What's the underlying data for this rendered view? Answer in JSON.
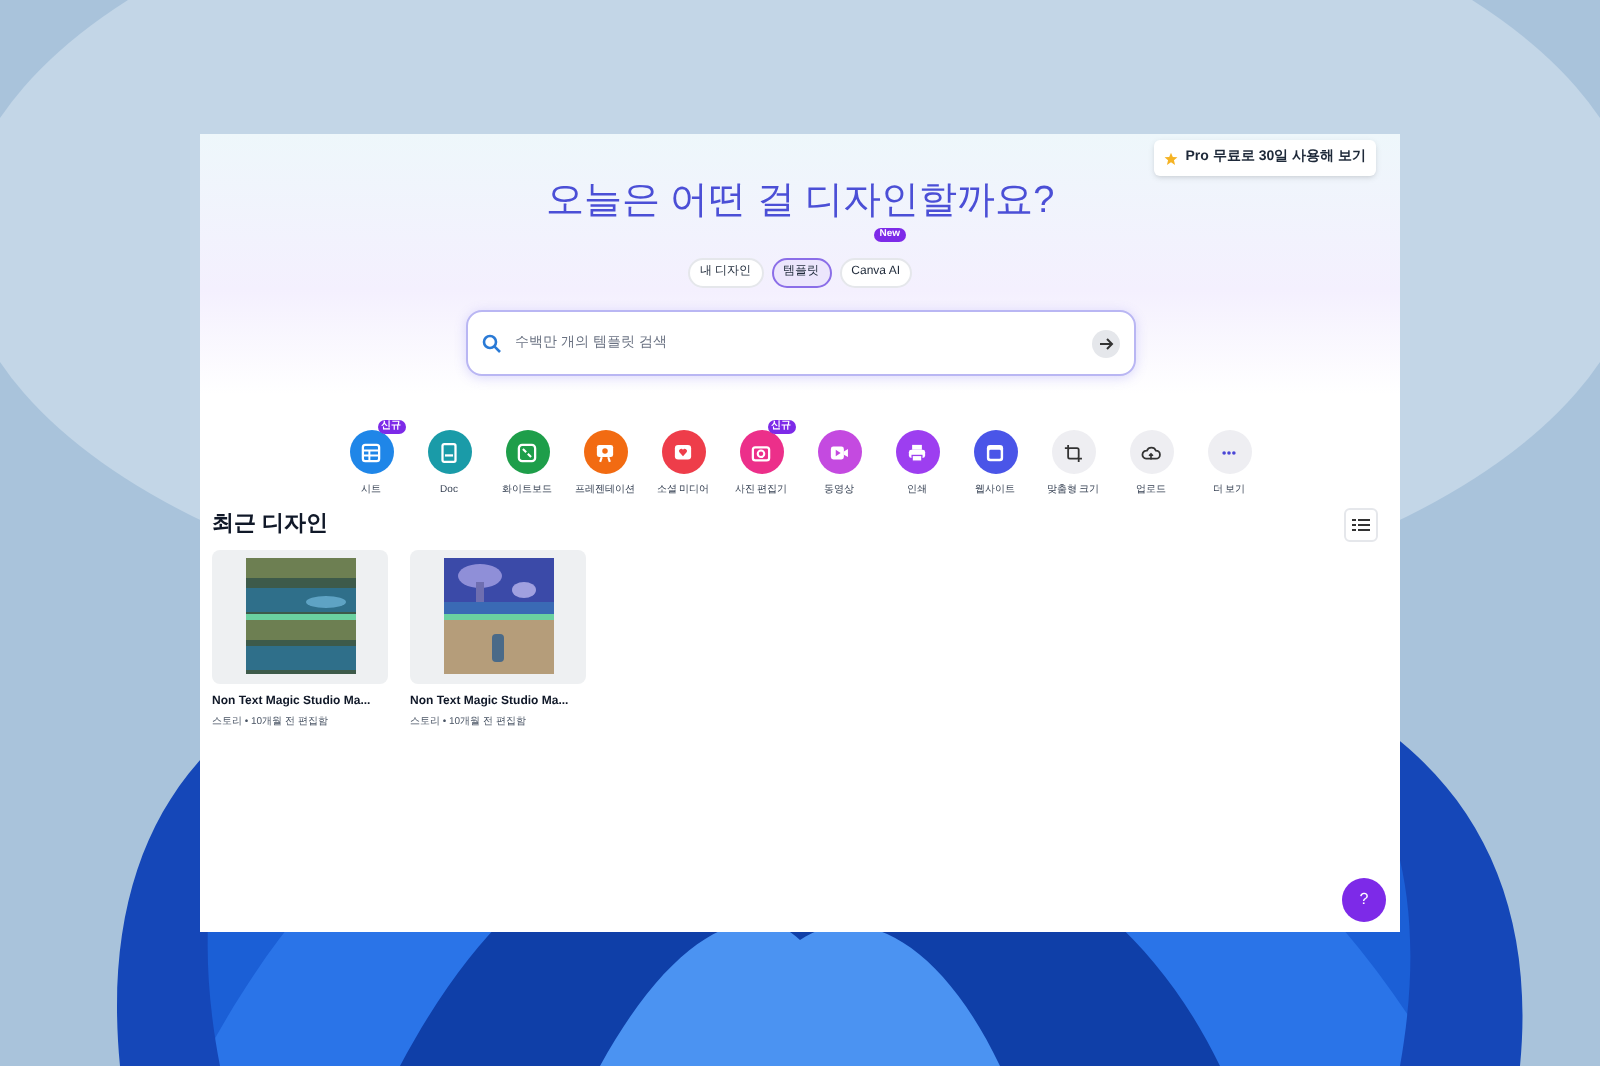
{
  "pro_button": {
    "label": "Pro 무료로 30일 사용해 보기"
  },
  "heading": "오늘은 어떤 걸 디자인할까요?",
  "tabs": [
    {
      "label": "내 디자인",
      "selected": false
    },
    {
      "label": "템플릿",
      "selected": true
    },
    {
      "label": "Canva AI",
      "selected": false,
      "badge": "New"
    }
  ],
  "search": {
    "placeholder": "수백만 개의 템플릿 검색"
  },
  "categories": [
    {
      "label": "시트",
      "color": "#1f86e8",
      "badge": "신규",
      "kind": "sheet"
    },
    {
      "label": "Doc",
      "color": "#1a9ba8",
      "kind": "doc"
    },
    {
      "label": "화이트보드",
      "color": "#1e9e4a",
      "kind": "whiteboard"
    },
    {
      "label": "프레젠테이션",
      "color": "#f26b12",
      "kind": "presentation"
    },
    {
      "label": "소셜 미디어",
      "color": "#ee3d4a",
      "kind": "social"
    },
    {
      "label": "사진 편집기",
      "color": "#ec2f8a",
      "badge": "신규"
    },
    {
      "label": "동영상",
      "color": "#c44ae0",
      "kind": "video"
    },
    {
      "label": "인쇄",
      "color": "#9d3ef0",
      "kind": "print"
    },
    {
      "label": "웹사이트",
      "color": "#4a55e8",
      "kind": "website"
    },
    {
      "label": "맞춤형 크기",
      "color": "#eeeef2",
      "kind": "custom"
    },
    {
      "label": "업로드",
      "color": "#eeeef2",
      "kind": "upload"
    },
    {
      "label": "더 보기",
      "color": "#eeeef2",
      "kind": "more"
    }
  ],
  "recent": {
    "title": "최근 디자인",
    "designs": [
      {
        "title": "Non Text Magic Studio Ma...",
        "meta": "스토리 • 10개월 전 편집함",
        "kind": "picture"
      },
      {
        "title": "Non Text Magic Studio Ma...",
        "meta": "스토리 • 10개월 전 편집함",
        "kind": "picture"
      }
    ]
  },
  "help_button": {
    "label": "?"
  }
}
